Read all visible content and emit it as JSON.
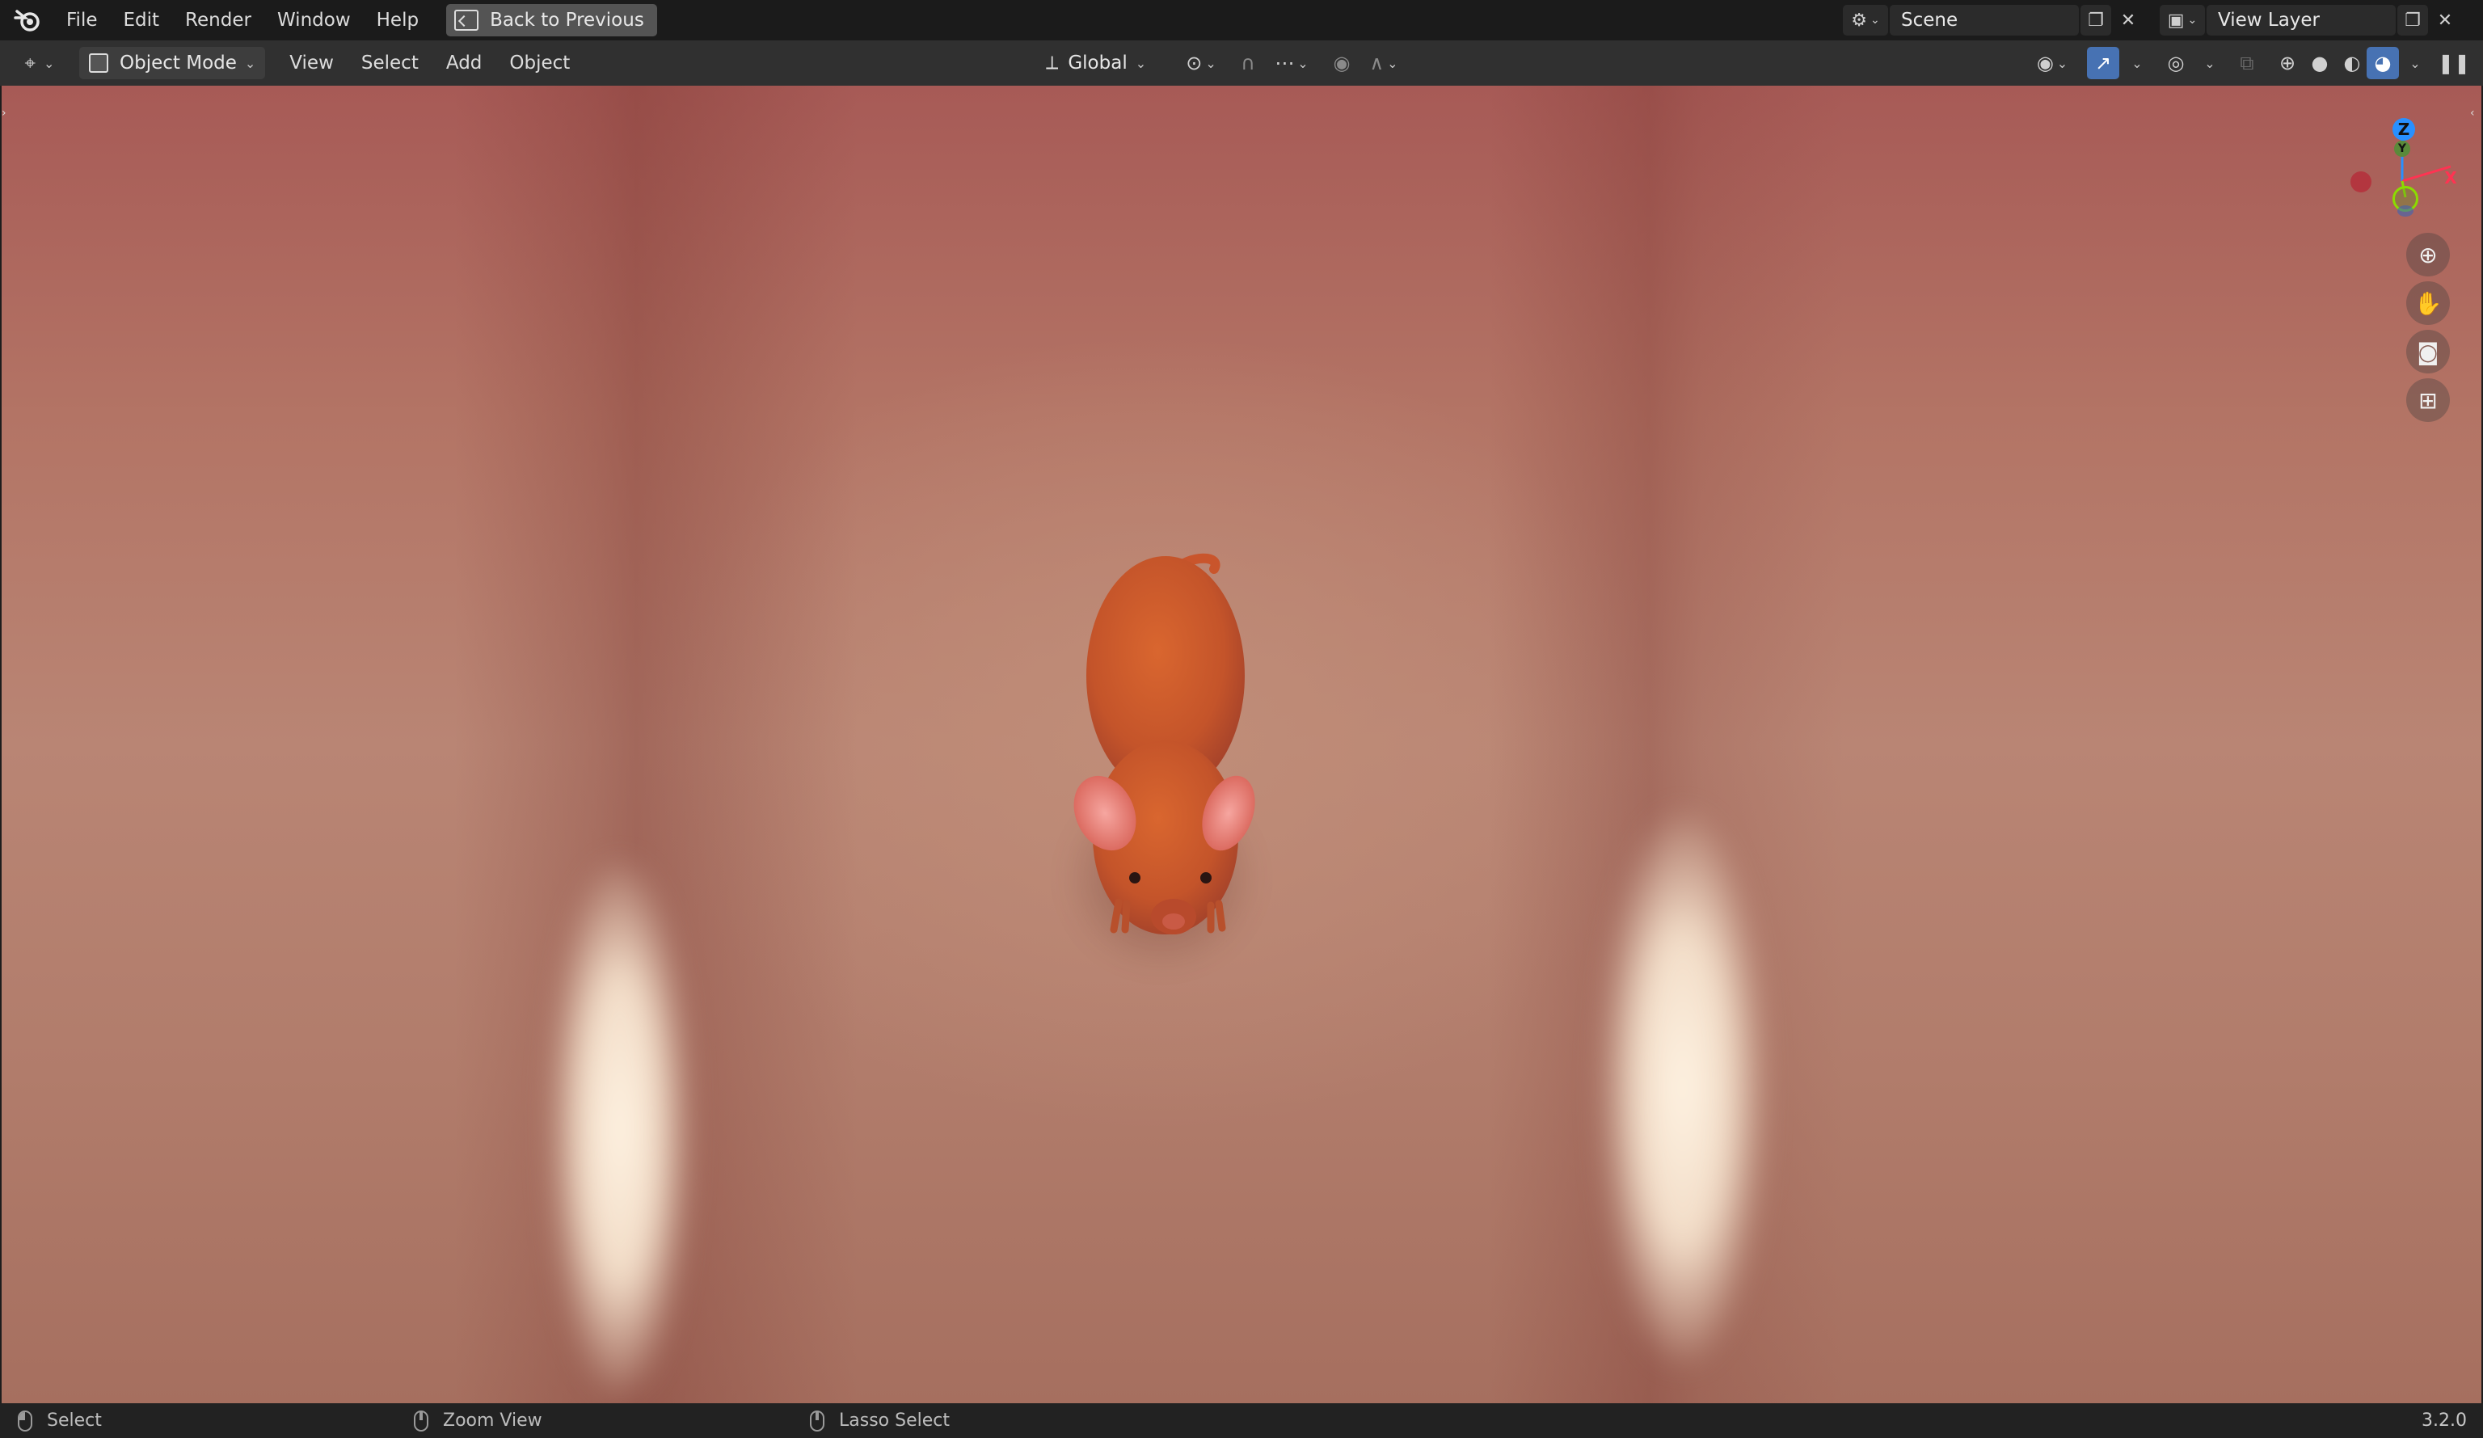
{
  "topbar": {
    "menus": [
      "File",
      "Edit",
      "Render",
      "Window",
      "Help"
    ],
    "back_button": "Back to Previous",
    "scene_label": "Scene",
    "view_layer_label": "View Layer"
  },
  "header": {
    "mode": "Object Mode",
    "menus": [
      "View",
      "Select",
      "Add",
      "Object"
    ],
    "transform_orientation": "Global"
  },
  "gizmo": {
    "z_label": "Z",
    "y_label": "Y",
    "x_label": "X",
    "x_color": "#ff3352",
    "y_color": "#8bdc00",
    "z_color": "#2890ff"
  },
  "statusbar": {
    "left_action": "Select",
    "middle_action": "Zoom View",
    "right_action": "Lasso Select",
    "version": "3.2.0"
  },
  "colors": {
    "accent": "#4772b3",
    "background_wall": "#a75a56",
    "mouse_body": "#cc5a2e",
    "mouse_ears": "#f08f88"
  }
}
